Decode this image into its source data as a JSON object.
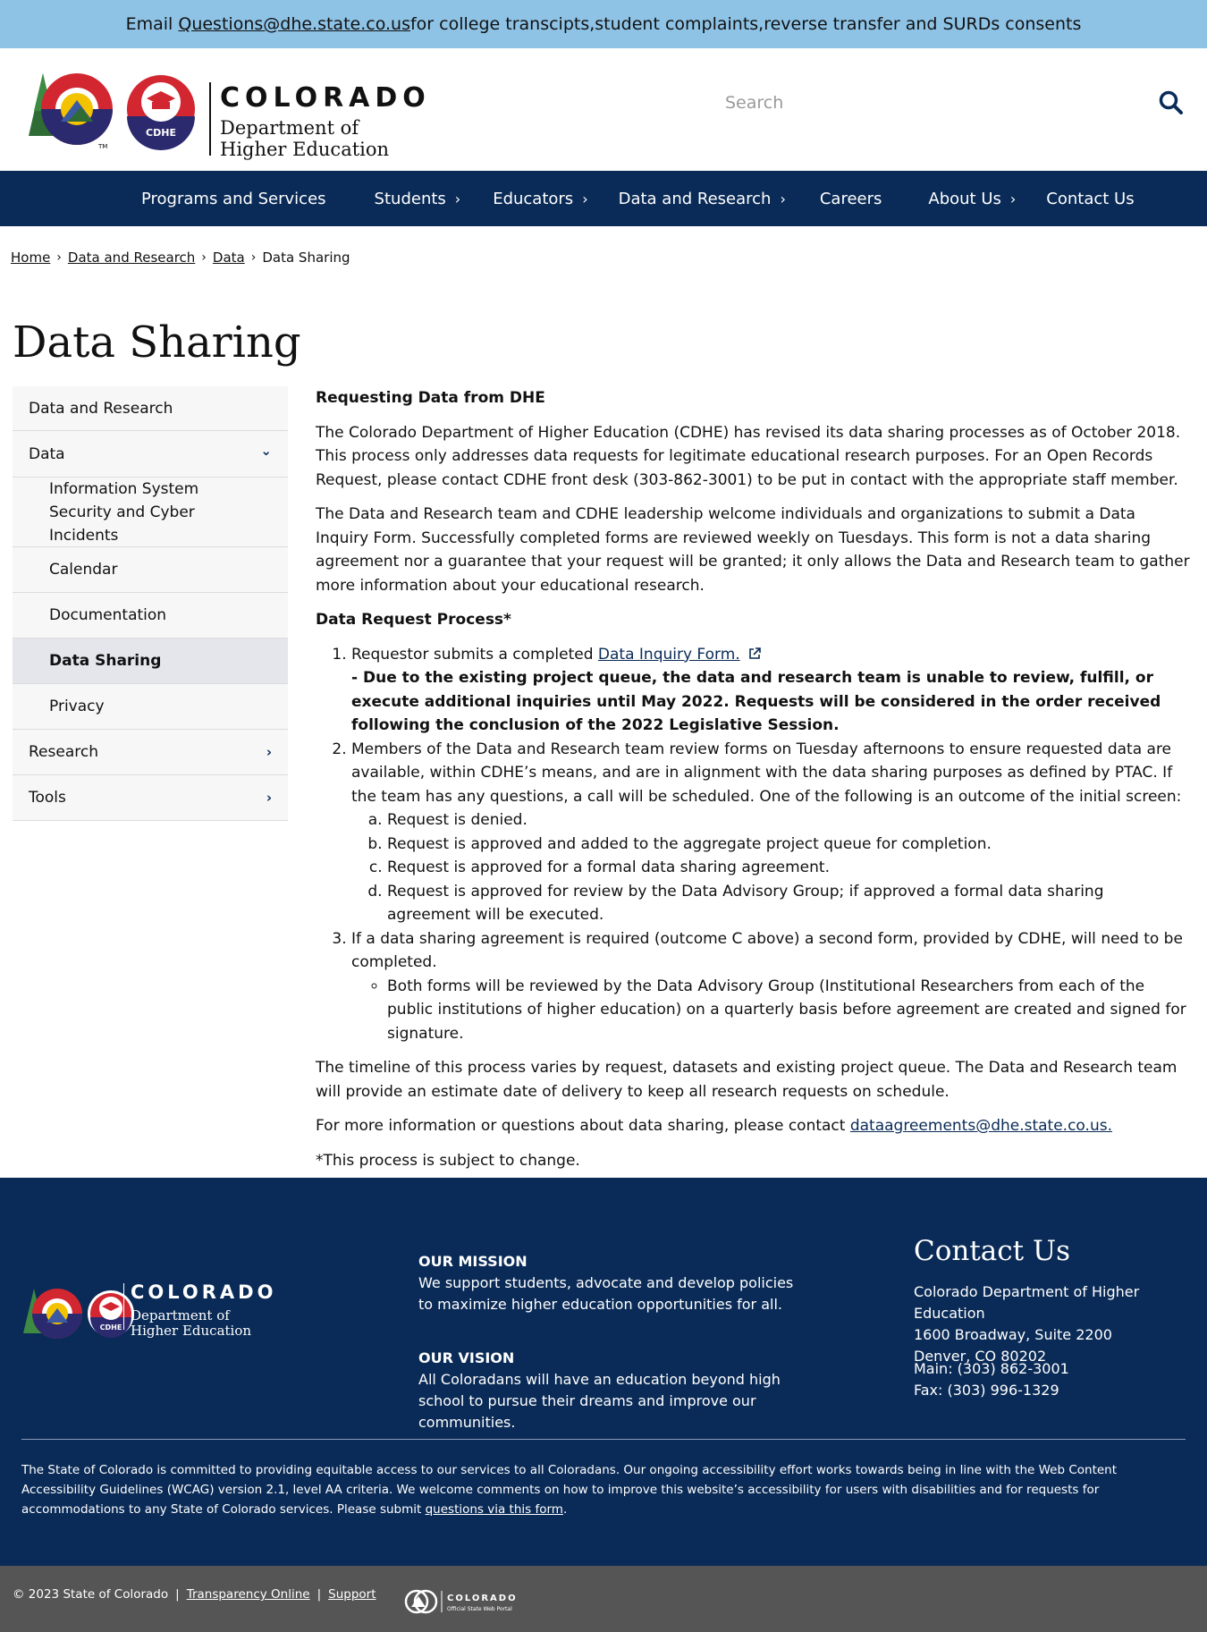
{
  "alert": {
    "prefix": "Email ",
    "email": "Questions@dhe.state.co.us",
    "suffix": " for college transcipts,student complaints,reverse transfer and SURDs consents"
  },
  "header": {
    "logo_word": "COLORADO",
    "logo_line1": "Department of",
    "logo_line2": "Higher Education",
    "logo_badge": "CDHE",
    "logo_tm": "TM",
    "search_placeholder": "Search"
  },
  "nav": {
    "items": [
      {
        "label": "Programs and Services",
        "has_chevron": false
      },
      {
        "label": "Students",
        "has_chevron": true
      },
      {
        "label": "Educators",
        "has_chevron": true
      },
      {
        "label": "Data and Research",
        "has_chevron": true
      },
      {
        "label": "Careers",
        "has_chevron": false
      },
      {
        "label": "About Us",
        "has_chevron": true
      },
      {
        "label": "Contact Us",
        "has_chevron": false
      }
    ],
    "chevron": "›"
  },
  "breadcrumb": {
    "items": [
      "Home",
      "Data and Research",
      "Data",
      "Data Sharing"
    ],
    "sep": "›"
  },
  "page_title": "Data Sharing",
  "sidebar": {
    "items": [
      {
        "label": "Data and Research",
        "level": 0,
        "chevron": "",
        "active": false
      },
      {
        "label": "Data",
        "level": 0,
        "chevron": "⌄",
        "active": false
      },
      {
        "label": "Information System Security and Cyber Incidents",
        "level": 1,
        "chevron": "",
        "active": false
      },
      {
        "label": "Calendar",
        "level": 1,
        "chevron": "",
        "active": false
      },
      {
        "label": "Documentation",
        "level": 1,
        "chevron": "",
        "active": false
      },
      {
        "label": "Data Sharing",
        "level": 1,
        "chevron": "",
        "active": true
      },
      {
        "label": "Privacy",
        "level": 1,
        "chevron": "",
        "active": false
      },
      {
        "label": "Research",
        "level": 0,
        "chevron": "›",
        "active": false
      },
      {
        "label": "Tools",
        "level": 0,
        "chevron": "›",
        "active": false
      }
    ]
  },
  "content": {
    "heading1": "Requesting Data from DHE",
    "para1": "The Colorado Department of Higher Education (CDHE) has revised its data sharing processes as of October 2018. This process only addresses data requests for legitimate educational research purposes. For an Open Records Request, please contact CDHE front desk (303-862-3001) to be put in contact with the appropriate staff member.",
    "para2": "The Data and Research team and CDHE leadership welcome individuals and organizations to submit a Data Inquiry Form. Successfully completed forms are reviewed weekly on Tuesdays. This form is not a data sharing agreement nor a guarantee that your request will be granted; it only allows the Data and Research team to gather more information about your educational research.",
    "heading2": "Data Request Process*",
    "step1_prefix": "Requestor submits a completed ",
    "step1_link": "Data Inquiry Form.",
    "step1_bold": "- Due to the existing project queue, the data and research team is unable to review, fulfill, or execute additional inquiries until May 2022. Requests will be considered in the order received following the conclusion of the 2022 Legislative Session.",
    "step2": "Members of the Data and Research team review forms on Tuesday afternoons to ensure requested data are available, within CDHE’s means, and are in alignment with the data sharing purposes as defined by PTAC. If the team has any questions, a call will be scheduled. One of the following is an outcome of the initial screen:",
    "step2_outcomes": [
      "Request is denied.",
      "Request is approved and added to the aggregate project queue for completion.",
      "Request is approved for a formal data sharing agreement.",
      "Request is approved for review by the Data Advisory Group; if approved a formal data sharing agreement will be executed."
    ],
    "step3": "If a data sharing agreement is required (outcome C above) a second form, provided by CDHE, will need to be completed.",
    "step3_bullet": "Both forms will be reviewed by the Data Advisory Group (Institutional Researchers from each of the public institutions of higher education) on a quarterly basis before agreement are created and signed for signature.",
    "para3": "The timeline of this process varies by request, datasets and existing project queue. The Data and Research team will provide an estimate date of delivery to keep all research requests on schedule.",
    "para4_prefix": "For more information or questions about data sharing, please contact ",
    "para4_link": "dataagreements@dhe.state.co.us.",
    "para5": "*This process is subject to change."
  },
  "footer": {
    "logo_word": "COLORADO",
    "logo_line1": "Department of",
    "logo_line2": "Higher Education",
    "logo_badge": "CDHE",
    "mission_title": "OUR MISSION",
    "mission_text": "We support students, advocate and develop policies to maximize higher education opportunities for all.",
    "vision_title": "OUR VISION",
    "vision_text": "All Coloradans will have an education beyond high school to pursue their dreams and improve our communities.",
    "contact_title": "Contact Us",
    "contact_org": "Colorado Department of Higher Education",
    "contact_addr1": "1600 Broadway, Suite 2200",
    "contact_addr2": "Denver, CO 80202",
    "contact_main": "Main: (303) 862-3001",
    "contact_fax": "Fax: (303) 996-1329",
    "accessibility_text": "The State of Colorado is committed to providing equitable access to our services to all Coloradans. Our ongoing accessibility effort works towards being in line with the Web Content Accessibility Guidelines (WCAG) version 2.1, level AA criteria. We welcome comments on how to improve this website’s accessibility for users with disabilities and for requests for accommodations to any State of Colorado services. Please submit ",
    "accessibility_link": "questions via this form",
    "accessibility_end": "."
  },
  "bottom": {
    "copyright": "© 2023 State of Colorado",
    "transparency": "Transparency Online",
    "support": "Support",
    "pipe": "|",
    "portal_word": "COLORADO",
    "portal_sub": "Official State Web Portal"
  },
  "colors": {
    "navy": "#0a2b57",
    "alert_bg": "#8ec3e6",
    "bottom_bg": "#555555",
    "sidebar_bg": "#f7f7f8",
    "sidebar_active": "#e4e6ec"
  }
}
